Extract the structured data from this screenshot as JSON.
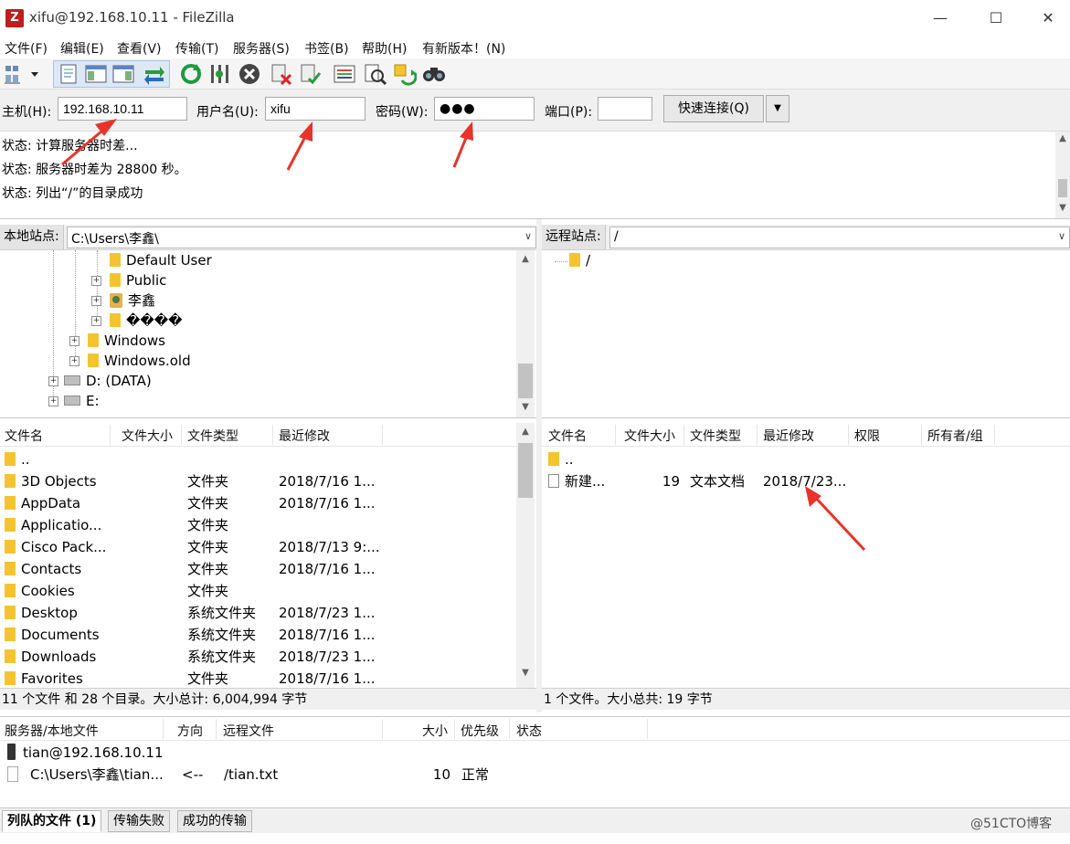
{
  "window": {
    "title": "xifu@192.168.10.11 - FileZilla",
    "app_icon": "Z",
    "controls": [
      "minimize-icon",
      "maximize-icon",
      "close-icon"
    ]
  },
  "menu": [
    "文件(F)",
    "编辑(E)",
    "查看(V)",
    "传输(T)",
    "服务器(S)",
    "书签(B)",
    "帮助(H)",
    "有新版本！(N)"
  ],
  "toolbar_icons": [
    "site-manager-icon",
    "toggle-log-icon",
    "toggle-local-tree-icon",
    "toggle-remote-tree-icon",
    "toggle-queue-icon",
    "refresh-icon",
    "process-queue-icon",
    "cancel-icon",
    "disconnect-icon",
    "reconnect-icon",
    "directory-filter-icon",
    "sync-browse-icon",
    "compare-icon",
    "search-icon"
  ],
  "quickconnect": {
    "host_label": "主机(H):",
    "host_value": "192.168.10.11",
    "user_label": "用户名(U):",
    "user_value": "xifu",
    "pass_label": "密码(W):",
    "pass_value": "●●●",
    "port_label": "端口(P):",
    "port_value": "",
    "button": "快速连接(Q)"
  },
  "log": [
    "状态:  计算服务器时差...",
    "状态:  服务器时差为 28800 秒。",
    "状态:  列出“/”的目录成功"
  ],
  "local": {
    "site_label": "本地站点:",
    "path": "C:\\Users\\李鑫\\",
    "tree": [
      {
        "label": "Default User",
        "icon": "folder"
      },
      {
        "label": "Public",
        "icon": "folder"
      },
      {
        "label": "李鑫",
        "icon": "user-folder"
      },
      {
        "label": "����",
        "icon": "folder"
      },
      {
        "label": "Windows",
        "icon": "folder"
      },
      {
        "label": "Windows.old",
        "icon": "folder"
      },
      {
        "label": "D: (DATA)",
        "icon": "drive"
      },
      {
        "label": "E:",
        "icon": "drive"
      }
    ],
    "columns": [
      "文件名",
      "文件大小",
      "文件类型",
      "最近修改"
    ],
    "files": [
      {
        "name": "..",
        "size": "",
        "type": "",
        "modified": ""
      },
      {
        "name": "3D Objects",
        "size": "",
        "type": "文件夹",
        "modified": "2018/7/16 1..."
      },
      {
        "name": "AppData",
        "size": "",
        "type": "文件夹",
        "modified": "2018/7/16 1..."
      },
      {
        "name": "Applicatio...",
        "size": "",
        "type": "文件夹",
        "modified": ""
      },
      {
        "name": "Cisco Pack...",
        "size": "",
        "type": "文件夹",
        "modified": "2018/7/13 9:..."
      },
      {
        "name": "Contacts",
        "size": "",
        "type": "文件夹",
        "modified": "2018/7/16 1..."
      },
      {
        "name": "Cookies",
        "size": "",
        "type": "文件夹",
        "modified": ""
      },
      {
        "name": "Desktop",
        "size": "",
        "type": "系统文件夹",
        "modified": "2018/7/23 1..."
      },
      {
        "name": "Documents",
        "size": "",
        "type": "系统文件夹",
        "modified": "2018/7/16 1..."
      },
      {
        "name": "Downloads",
        "size": "",
        "type": "系统文件夹",
        "modified": "2018/7/23 1..."
      },
      {
        "name": "Favorites",
        "size": "",
        "type": "文件夹",
        "modified": "2018/7/16 1..."
      }
    ],
    "status": "11 个文件 和 28 个目录。大小总计: 6,004,994 字节"
  },
  "remote": {
    "site_label": "远程站点:",
    "path": "/",
    "tree": [
      {
        "label": "/",
        "icon": "folder"
      }
    ],
    "columns": [
      "文件名",
      "文件大小",
      "文件类型",
      "最近修改",
      "权限",
      "所有者/组"
    ],
    "files": [
      {
        "name": "..",
        "size": "",
        "type": "",
        "modified": "",
        "icon": "folder"
      },
      {
        "name": "新建...",
        "size": "19",
        "type": "文本文档",
        "modified": "2018/7/23...",
        "icon": "doc"
      }
    ],
    "status": "1 个文件。大小总共: 19 字节"
  },
  "queue": {
    "columns": [
      "服务器/本地文件",
      "方向",
      "远程文件",
      "大小",
      "优先级",
      "状态"
    ],
    "server": "tian@192.168.10.11",
    "item": {
      "local": "C:\\Users\\李鑫\\tian...",
      "direction": "<--",
      "remote": "/tian.txt",
      "size": "10",
      "priority": "正常",
      "status": ""
    },
    "tabs": [
      "列队的文件 (1)",
      "传输失败",
      "成功的传输"
    ]
  },
  "watermark": "@51CTO博客",
  "colors": {
    "arrow": "#e8332a",
    "folder": "#f4c430",
    "titlebar": "#ffffff",
    "panel": "#f0f0f0"
  }
}
